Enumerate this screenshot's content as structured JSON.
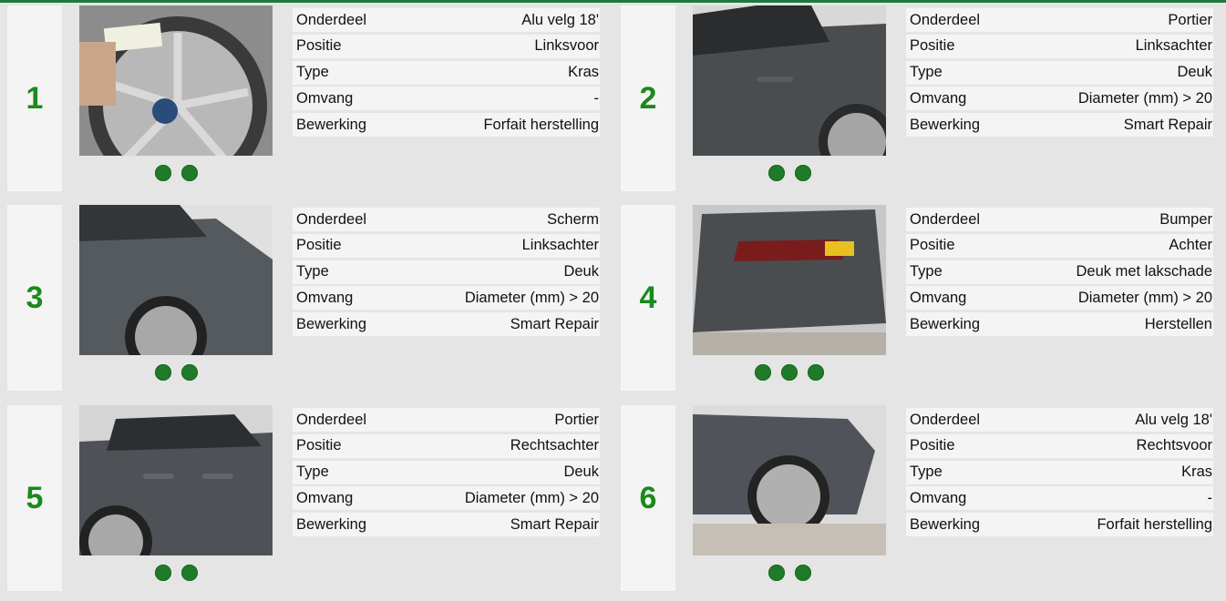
{
  "colors": {
    "accent": "#1a8a1a",
    "dot": "#1f7a2a",
    "topbar": "#1e7a3c"
  },
  "labels": {
    "part": "Onderdeel",
    "position": "Positie",
    "type": "Type",
    "extent": "Omvang",
    "action": "Bewerking"
  },
  "damages": [
    {
      "number": "1",
      "part": "Alu velg 18'",
      "position": "Linksvoor",
      "type": "Kras",
      "extent": "-",
      "action": "Forfait herstelling",
      "photo_count": 2,
      "photo": "wheel-closeup-with-ruler"
    },
    {
      "number": "2",
      "part": "Portier",
      "position": "Linksachter",
      "type": "Deuk",
      "extent": "Diameter (mm) > 20",
      "action": "Smart Repair",
      "photo_count": 2,
      "photo": "rear-door-left"
    },
    {
      "number": "3",
      "part": "Scherm",
      "position": "Linksachter",
      "type": "Deuk",
      "extent": "Diameter (mm) > 20",
      "action": "Smart Repair",
      "photo_count": 2,
      "photo": "rear-fender-left"
    },
    {
      "number": "4",
      "part": "Bumper",
      "position": "Achter",
      "type": "Deuk met lakschade",
      "extent": "Diameter (mm) > 20",
      "action": "Herstellen",
      "photo_count": 3,
      "photo": "rear-bumper"
    },
    {
      "number": "5",
      "part": "Portier",
      "position": "Rechtsachter",
      "type": "Deuk",
      "extent": "Diameter (mm) > 20",
      "action": "Smart Repair",
      "photo_count": 2,
      "photo": "rear-door-right"
    },
    {
      "number": "6",
      "part": "Alu velg 18'",
      "position": "Rechtsvoor",
      "type": "Kras",
      "extent": "-",
      "action": "Forfait herstelling",
      "photo_count": 2,
      "photo": "front-wheel-right"
    }
  ]
}
